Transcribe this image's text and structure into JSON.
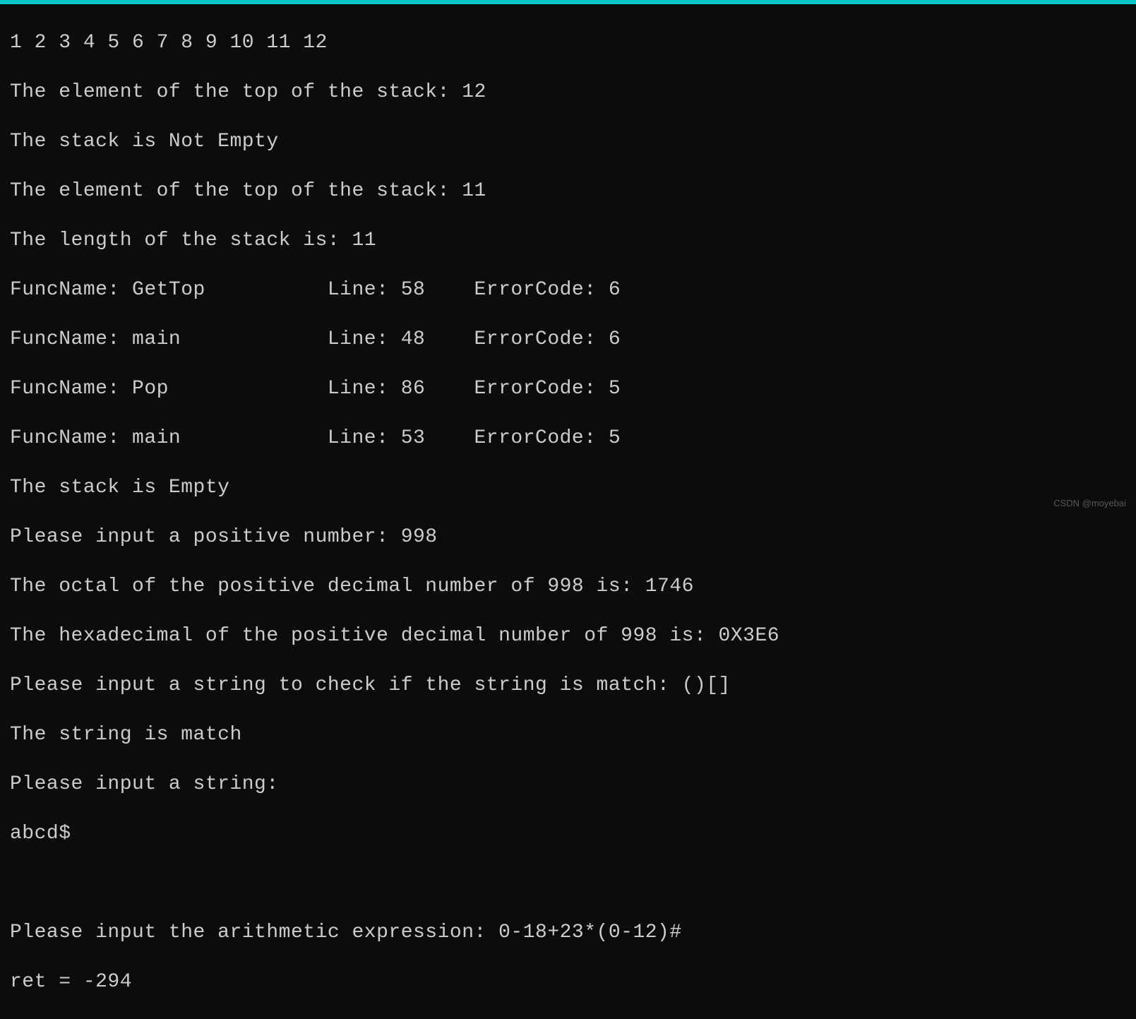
{
  "lines": [
    "1 2 3 4 5 6 7 8 9 10 11 12",
    "The element of the top of the stack: 12",
    "The stack is Not Empty",
    "The element of the top of the stack: 11",
    "The length of the stack is: 11",
    "FuncName: GetTop          Line: 58    ErrorCode: 6",
    "FuncName: main            Line: 48    ErrorCode: 6",
    "FuncName: Pop             Line: 86    ErrorCode: 5",
    "FuncName: main            Line: 53    ErrorCode: 5",
    "The stack is Empty",
    "Please input a positive number: 998",
    "The octal of the positive decimal number of 998 is: 1746",
    "The hexadecimal of the positive decimal number of 998 is: 0X3E6",
    "Please input a string to check if the string is match: ()[]",
    "The string is match",
    "Please input a string:",
    "abcd$",
    "",
    "Please input the arithmetic expression: 0-18+23*(0-12)#",
    "ret = -294"
  ],
  "watermark": "CSDN @moyebai"
}
